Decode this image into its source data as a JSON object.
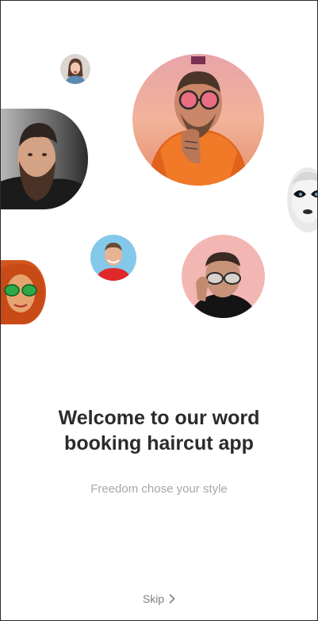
{
  "onboarding": {
    "title": "Welcome to our word booking haircut app",
    "subtitle": "Freedom chose your style",
    "skip_label": "Skip",
    "skip_icon": "chevron-right-icon"
  },
  "avatars": [
    {
      "name": "avatar-girl-small",
      "bg": "#d8d0cb"
    },
    {
      "name": "avatar-sunglasses-hood",
      "bg": "#e7a08e"
    },
    {
      "name": "avatar-bearded-man",
      "bg": "#3b3b3b"
    },
    {
      "name": "avatar-painted-face",
      "bg": "#e8e8e8"
    },
    {
      "name": "avatar-smiling-man",
      "bg": "#7ec3e6"
    },
    {
      "name": "avatar-glasses-man",
      "bg": "#f0b4b0"
    },
    {
      "name": "avatar-green-glasses-woman",
      "bg": "#c2521f"
    }
  ],
  "colors": {
    "title": "#2b2b2b",
    "subtitle": "#a7a7a7",
    "skip": "#7f7f7f",
    "background": "#ffffff"
  }
}
